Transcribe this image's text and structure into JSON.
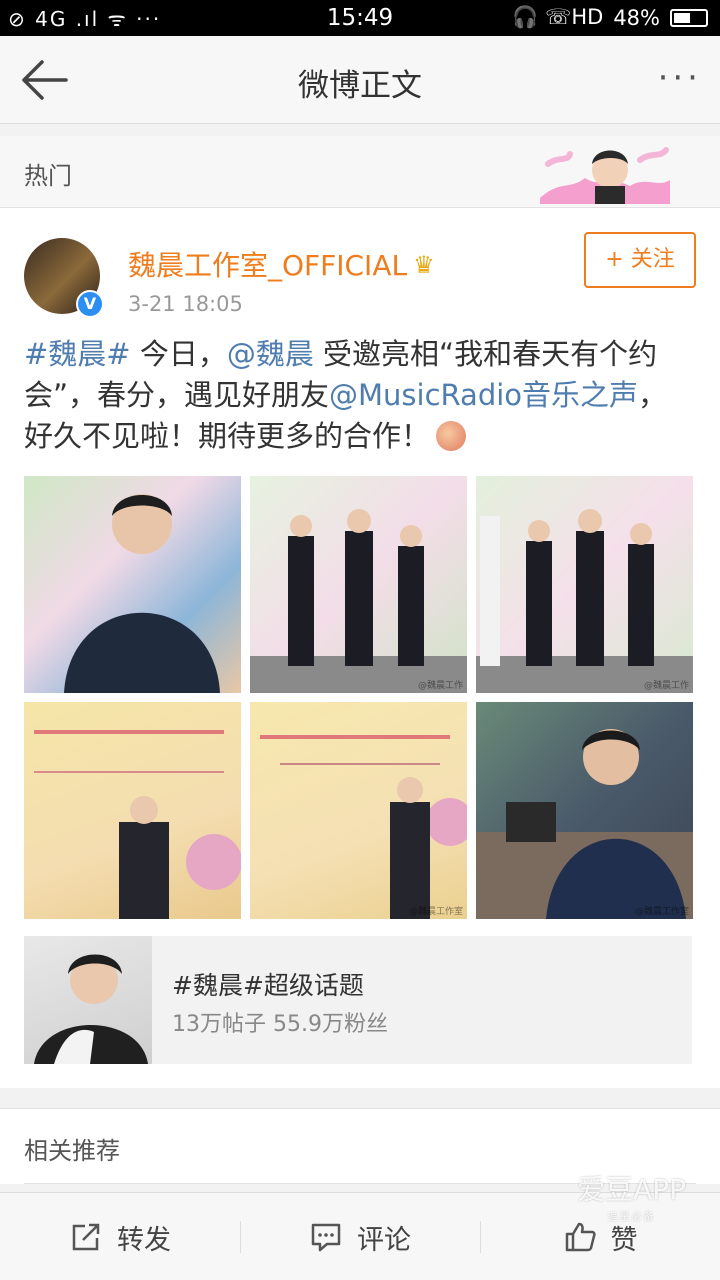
{
  "status_bar": {
    "left": "⊘ 4G .ıl ᯤ ···",
    "time": "15:49",
    "right_icons": "🎧 ☏HD",
    "battery": "48%",
    "battery_level": 0.48
  },
  "nav": {
    "title": "微博正文",
    "back_icon": "back-arrow-icon",
    "more_icon": "more-dots-icon",
    "more_text": "···"
  },
  "hot": {
    "label": "热门"
  },
  "post": {
    "username": "魏晨工作室_OFFICIAL",
    "crown": "♛",
    "time": "3-21 18:05",
    "follow_label": "关注",
    "follow_plus": "+",
    "verified_mark": "V",
    "content": {
      "topic_tag": "#魏晨#",
      "text1": " 今日，",
      "mention1": "@魏晨",
      "text2": " 受邀亮相“我和春天有个约会”，春分，遇见好朋友",
      "mention2": "@MusicRadio音乐之声",
      "text3": "，好久不见啦！期待更多的合作！"
    },
    "photos": [
      {
        "watermark": ""
      },
      {
        "watermark": "@魏晨工作"
      },
      {
        "watermark": "@魏晨工作"
      },
      {
        "watermark": ""
      },
      {
        "watermark": "@魏晨工作室"
      },
      {
        "watermark": "@魏晨工作室"
      }
    ],
    "topic_card": {
      "title": "#魏晨#超级话题",
      "subtitle": "13万帖子 55.9万粉丝"
    }
  },
  "related": {
    "label": "相关推荐"
  },
  "bottom_bar": {
    "repost": "转发",
    "comment": "评论",
    "like": "赞"
  },
  "watermark": {
    "brand": "爱豆APP",
    "slogan": "追星必备"
  },
  "colors": {
    "accent": "#f07d1d",
    "link": "#507daf",
    "verify": "#2b8ef0"
  }
}
